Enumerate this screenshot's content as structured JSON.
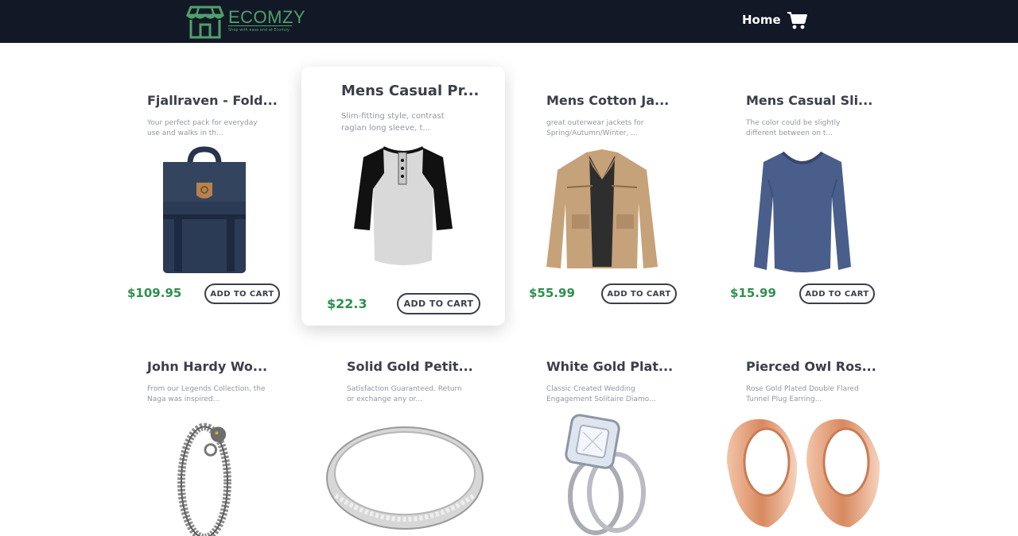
{
  "brand": {
    "name": "ECOMZY",
    "tagline": "Shop with ease and at Ecomzy"
  },
  "nav": {
    "home_label": "Home",
    "cart_icon": "shopping-cart-icon"
  },
  "colors": {
    "navbar": "#121826",
    "brand_green": "#4fa06a",
    "price_green": "#2f8f4e",
    "text_dark": "#3a3f4b",
    "text_muted": "#9098a4"
  },
  "products": [
    {
      "title": "Fjallraven - Fold...",
      "description": "Your perfect pack for everyday use and walks in th...",
      "price": "$109.95",
      "button": "ADD TO CART",
      "image": "backpack"
    },
    {
      "title": "Mens Casual Pr...",
      "description": "Slim-fitting style, contrast raglan long sleeve, t...",
      "price": "$22.3",
      "button": "ADD TO CART",
      "image": "raglan-shirt"
    },
    {
      "title": "Mens Cotton Ja...",
      "description": "great outerwear jackets for Spring/Autumn/Winter, ...",
      "price": "$55.99",
      "button": "ADD TO CART",
      "image": "cotton-jacket"
    },
    {
      "title": "Mens Casual Sli...",
      "description": "The color could be slightly different between on t...",
      "price": "$15.99",
      "button": "ADD TO CART",
      "image": "slim-shirt"
    },
    {
      "title": "John Hardy Wo...",
      "description": "From our Legends Collection, the Naga was inspired...",
      "price": "",
      "button": "",
      "image": "dragon-bracelet"
    },
    {
      "title": "Solid Gold Petit...",
      "description": "Satisfaction Guaranteed. Return or exchange any or...",
      "price": "",
      "button": "",
      "image": "silver-band"
    },
    {
      "title": "White Gold Plat...",
      "description": "Classic Created Wedding Engagement Solitaire Diamo...",
      "price": "",
      "button": "",
      "image": "engagement-ring"
    },
    {
      "title": "Pierced Owl Ros...",
      "description": "Rose Gold Plated Double Flared Tunnel Plug Earring...",
      "price": "",
      "button": "",
      "image": "tunnel-plugs"
    }
  ]
}
